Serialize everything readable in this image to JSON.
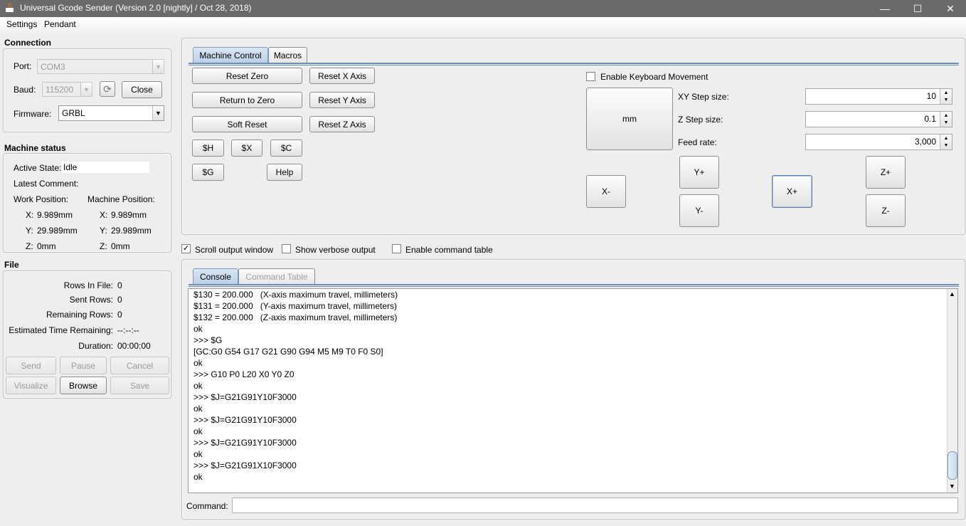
{
  "window": {
    "title": "Universal Gcode Sender (Version 2.0 [nightly]  / Oct 28, 2018)",
    "minimize_glyph": "—",
    "maximize_glyph": "☐",
    "close_glyph": "✕"
  },
  "menubar": {
    "items": [
      "Settings",
      "Pendant"
    ]
  },
  "connection": {
    "title": "Connection",
    "port_label": "Port:",
    "port_value": "COM3",
    "baud_label": "Baud:",
    "baud_value": "115200",
    "refresh_glyph": "⟳",
    "close_label": "Close",
    "firmware_label": "Firmware:",
    "firmware_value": "GRBL"
  },
  "machine_status": {
    "title": "Machine status",
    "active_state_label": "Active State:",
    "active_state_value": "Idle",
    "latest_comment_label": "Latest Comment:",
    "work_position_label": "Work Position:",
    "machine_position_label": "Machine Position:",
    "work": {
      "x_label": "X:",
      "x": "9.989mm",
      "y_label": "Y:",
      "y": "29.989mm",
      "z_label": "Z:",
      "z": "0mm"
    },
    "machine": {
      "x_label": "X:",
      "x": "9.989mm",
      "y_label": "Y:",
      "y": "29.989mm",
      "z_label": "Z:",
      "z": "0mm"
    }
  },
  "file": {
    "title": "File",
    "rows_in_file_label": "Rows In File:",
    "rows_in_file": "0",
    "sent_rows_label": "Sent Rows:",
    "sent_rows": "0",
    "remaining_rows_label": "Remaining Rows:",
    "remaining_rows": "0",
    "est_time_label": "Estimated Time Remaining:",
    "est_time": "--:--:--",
    "duration_label": "Duration:",
    "duration": "00:00:00",
    "buttons": {
      "send": "Send",
      "pause": "Pause",
      "cancel": "Cancel",
      "visualize": "Visualize",
      "browse": "Browse",
      "save": "Save"
    }
  },
  "machine_control": {
    "tabs": [
      "Machine Control",
      "Macros"
    ],
    "reset_zero": "Reset Zero",
    "return_to_zero": "Return to Zero",
    "soft_reset": "Soft Reset",
    "reset_x": "Reset X Axis",
    "reset_y": "Reset Y Axis",
    "reset_z": "Reset Z Axis",
    "cmd_h": "$H",
    "cmd_x": "$X",
    "cmd_c": "$C",
    "cmd_g": "$G",
    "help": "Help",
    "enable_keyboard": "Enable Keyboard Movement",
    "units_button": "mm",
    "xy_step_label": "XY Step size:",
    "xy_step_value": "10",
    "z_step_label": "Z Step size:",
    "z_step_value": "0.1",
    "feed_rate_label": "Feed rate:",
    "feed_rate_value": "3,000",
    "jog": {
      "x_minus": "X-",
      "x_plus": "X+",
      "y_plus": "Y+",
      "y_minus": "Y-",
      "z_plus": "Z+",
      "z_minus": "Z-"
    },
    "spin_up_glyph": "▲",
    "spin_down_glyph": "▼"
  },
  "options": {
    "scroll_output": "Scroll output window",
    "scroll_output_checked": true,
    "verbose_output": "Show verbose output",
    "command_table": "Enable command table",
    "check_glyph": "✓"
  },
  "console": {
    "tabs": [
      "Console",
      "Command Table"
    ],
    "lines": [
      "$130 = 200.000   (X-axis maximum travel, millimeters)",
      "$131 = 200.000   (Y-axis maximum travel, millimeters)",
      "$132 = 200.000   (Z-axis maximum travel, millimeters)",
      "ok",
      ">>> $G",
      "[GC:G0 G54 G17 G21 G90 G94 M5 M9 T0 F0 S0]",
      "ok",
      ">>> G10 P0 L20 X0 Y0 Z0",
      "ok",
      ">>> $J=G21G91Y10F3000",
      "ok",
      ">>> $J=G21G91Y10F3000",
      "ok",
      ">>> $J=G21G91Y10F3000",
      "ok",
      ">>> $J=G21G91X10F3000",
      "ok"
    ],
    "command_label": "Command:",
    "command_value": ""
  }
}
